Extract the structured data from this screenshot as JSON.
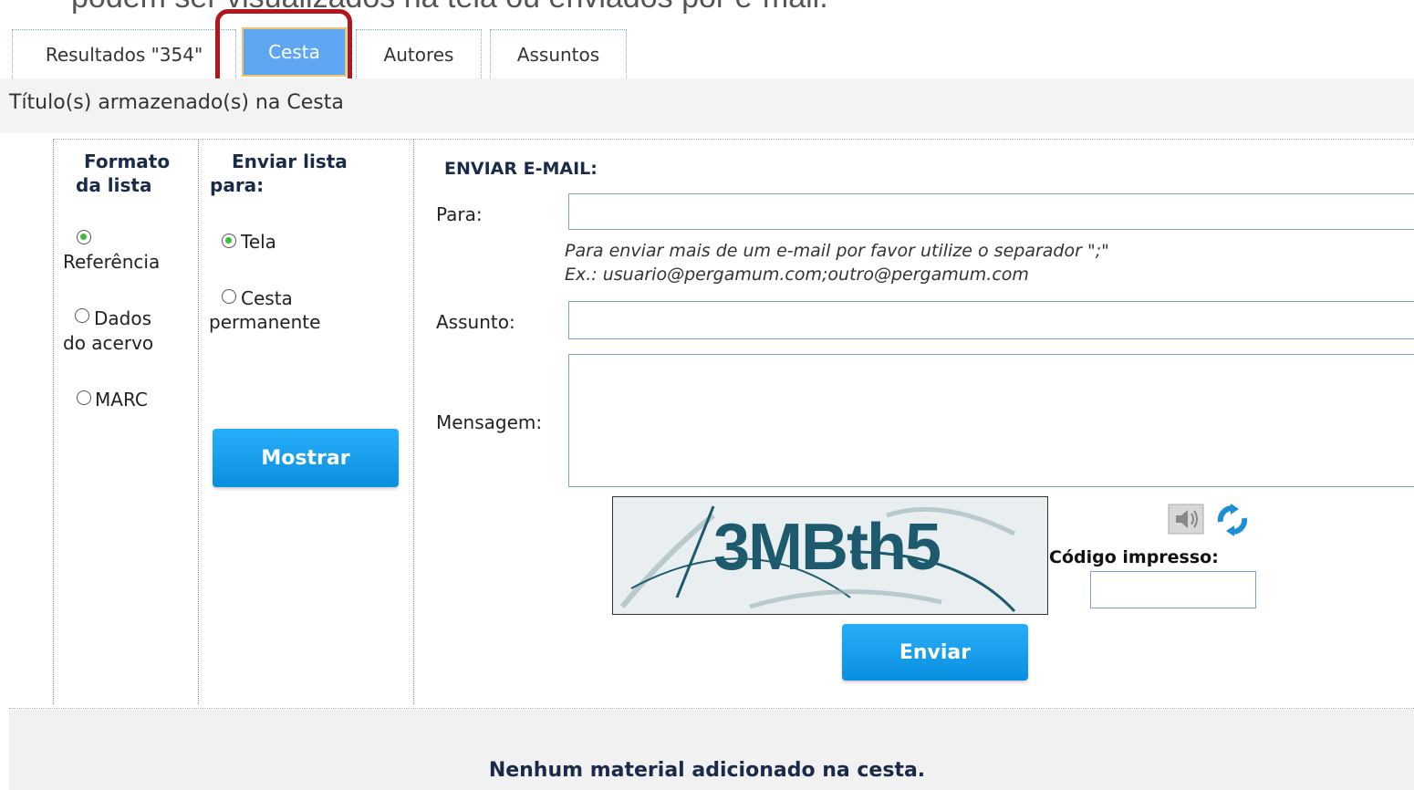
{
  "caption": "podem ser visualizados na tela ou enviados por e-mail.",
  "tabs": [
    {
      "label": "Resultados \"354\""
    },
    {
      "label": "Cesta"
    },
    {
      "label": "Autores"
    },
    {
      "label": "Assuntos"
    }
  ],
  "page_title": "Título(s) armazenado(s) na Cesta",
  "format": {
    "heading_line1": "Formato",
    "heading_line2": "da lista",
    "options": [
      {
        "label": "Referência",
        "checked": true
      },
      {
        "label_line1": "Dados",
        "label_line2": "do acervo",
        "checked": false
      },
      {
        "label": "MARC",
        "checked": false
      }
    ]
  },
  "send_to": {
    "heading_line1": "Enviar lista",
    "heading_line2": "para:",
    "options": [
      {
        "label": "Tela",
        "checked": true
      },
      {
        "label_line1": "Cesta",
        "label_line2": "permanente",
        "checked": false
      }
    ],
    "show_button": "Mostrar"
  },
  "email": {
    "heading": "ENVIAR E-MAIL:",
    "to_label": "Para:",
    "to_value": "",
    "hint_line1": "Para enviar mais de um e-mail por favor utilize o separador \";\"",
    "hint_line2": "Ex.: usuario@pergamum.com;outro@pergamum.com",
    "subject_label": "Assunto:",
    "subject_value": "",
    "message_label": "Mensagem:",
    "message_value": "",
    "captcha_text": "3MBth5",
    "captcha_code_label": "Código impresso:",
    "captcha_code_value": "",
    "send_button": "Enviar"
  },
  "empty_message": "Nenhum material adicionado na cesta.",
  "colors": {
    "accent_blue": "#1a9ef0",
    "active_tab": "#5ea6f2",
    "highlight_border": "#b3161c"
  },
  "icons": [
    "audio-icon",
    "refresh-icon"
  ]
}
